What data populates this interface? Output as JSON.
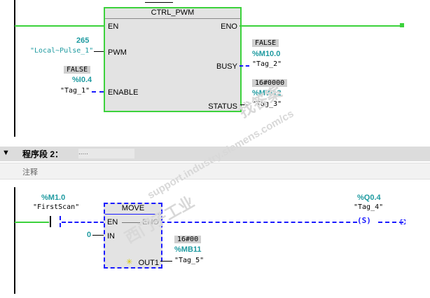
{
  "network1": {
    "block": {
      "title": "CTRL_PWM",
      "pins": {
        "en": "EN",
        "eno": "ENO",
        "pwm": "PWM",
        "enable": "ENABLE",
        "busy": "BUSY",
        "status": "STATUS"
      }
    },
    "pwm_input": {
      "value": "265",
      "tag": "\"Local~Pulse_1\""
    },
    "enable_input": {
      "value": "FALSE",
      "address": "%I0.4",
      "tag": "\"Tag_1\""
    },
    "busy_output": {
      "value": "FALSE",
      "address": "%M10.0",
      "tag": "\"Tag_2\""
    },
    "status_output": {
      "value": "16#0000",
      "address": "%MW12",
      "tag": "\"Tag_3\""
    }
  },
  "network2": {
    "header": {
      "label": "程序段 2：",
      "dots": ".....",
      "toggle": "▼"
    },
    "comment": "注释",
    "contact": {
      "address": "%M1.0",
      "tag": "\"FirstScan\""
    },
    "coil": {
      "address": "%Q0.4",
      "tag": "\"Tag_4\"",
      "symbol": "S"
    },
    "block": {
      "title": "MOVE",
      "pins": {
        "en": "EN",
        "eno": "ENO",
        "in": "IN",
        "out": "OUT1"
      }
    },
    "in_value": "0",
    "out_output": {
      "value": "16#00",
      "address": "%MB11",
      "tag": "\"Tag_5\""
    }
  },
  "watermark": {
    "line1": "西门子工业",
    "line2": "support.industry.siemens.com/cs",
    "line3": "找答案"
  }
}
